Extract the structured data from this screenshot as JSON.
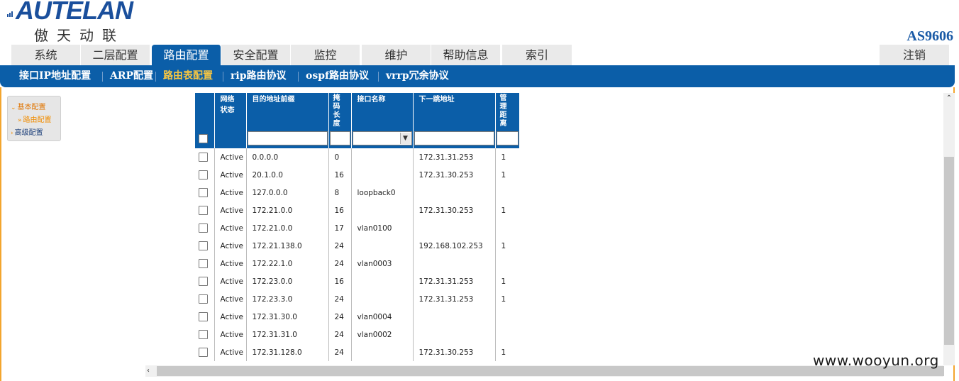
{
  "logo": {
    "wordmark": "AUTELAN",
    "cn": "傲天动联"
  },
  "model": "AS9606",
  "main_tabs": [
    {
      "label": "系统"
    },
    {
      "label": "二层配置"
    },
    {
      "label": "路由配置",
      "active": true
    },
    {
      "label": "安全配置"
    },
    {
      "label": "监控"
    },
    {
      "label": "维护"
    },
    {
      "label": "帮助信息"
    },
    {
      "label": "索引"
    }
  ],
  "logout_label": "注销",
  "sub_tabs": [
    {
      "label": "接口IP地址配置"
    },
    {
      "label": "ARP配置"
    },
    {
      "label": "路由表配置",
      "active": true
    },
    {
      "label": "rip路由协议"
    },
    {
      "label": "ospf路由协议"
    },
    {
      "label": "vrrp冗余协议"
    }
  ],
  "side_menu": {
    "basic": "基本配置",
    "route": "路由配置",
    "advanced": "高级配置"
  },
  "table": {
    "headers": {
      "status": "网络\n状态",
      "prefix": "目的地址前缀",
      "masklen": "掩\n码\n长\n度",
      "ifname": "接口名称",
      "nexthop": "下一跳地址",
      "distance": "管\n理\n距\n离"
    },
    "rows": [
      {
        "status": "Active",
        "prefix": "0.0.0.0",
        "masklen": "0",
        "ifname": "",
        "nexthop": "172.31.31.253",
        "distance": "1"
      },
      {
        "status": "Active",
        "prefix": "20.1.0.0",
        "masklen": "16",
        "ifname": "",
        "nexthop": "172.31.30.253",
        "distance": "1"
      },
      {
        "status": "Active",
        "prefix": "127.0.0.0",
        "masklen": "8",
        "ifname": "loopback0",
        "nexthop": "",
        "distance": ""
      },
      {
        "status": "Active",
        "prefix": "172.21.0.0",
        "masklen": "16",
        "ifname": "",
        "nexthop": "172.31.30.253",
        "distance": "1"
      },
      {
        "status": "Active",
        "prefix": "172.21.0.0",
        "masklen": "17",
        "ifname": "vlan0100",
        "nexthop": "",
        "distance": ""
      },
      {
        "status": "Active",
        "prefix": "172.21.138.0",
        "masklen": "24",
        "ifname": "",
        "nexthop": "192.168.102.253",
        "distance": "1"
      },
      {
        "status": "Active",
        "prefix": "172.22.1.0",
        "masklen": "24",
        "ifname": "vlan0003",
        "nexthop": "",
        "distance": ""
      },
      {
        "status": "Active",
        "prefix": "172.23.0.0",
        "masklen": "16",
        "ifname": "",
        "nexthop": "172.31.31.253",
        "distance": "1"
      },
      {
        "status": "Active",
        "prefix": "172.23.3.0",
        "masklen": "24",
        "ifname": "",
        "nexthop": "172.31.31.253",
        "distance": "1"
      },
      {
        "status": "Active",
        "prefix": "172.31.30.0",
        "masklen": "24",
        "ifname": "vlan0004",
        "nexthop": "",
        "distance": ""
      },
      {
        "status": "Active",
        "prefix": "172.31.31.0",
        "masklen": "24",
        "ifname": "vlan0002",
        "nexthop": "",
        "distance": ""
      },
      {
        "status": "Active",
        "prefix": "172.31.128.0",
        "masklen": "24",
        "ifname": "",
        "nexthop": "172.31.30.253",
        "distance": "1"
      }
    ]
  },
  "watermark": "www.wooyun.org",
  "colors": {
    "brand_blue": "#0b5ea8",
    "active_sub": "#f5c542",
    "frame_orange": "#f3a52e"
  }
}
